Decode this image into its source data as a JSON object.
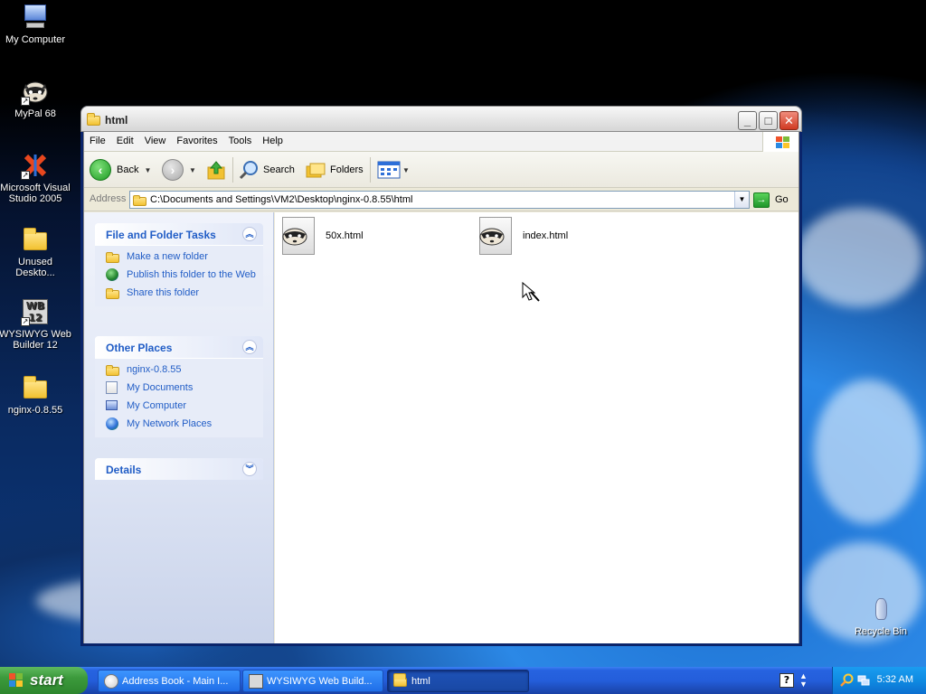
{
  "desktop": {
    "icons": [
      {
        "label": "My Computer"
      },
      {
        "label": "MyPal 68"
      },
      {
        "label": "Microsoft Visual Studio 2005"
      },
      {
        "label": "Unused Deskto..."
      },
      {
        "label": "WYSIWYG Web Builder 12"
      },
      {
        "label": "nginx-0.8.55"
      },
      {
        "label": "Recycle Bin"
      }
    ]
  },
  "window": {
    "title": "html",
    "controls": {
      "minimize": "_",
      "maximize": "□",
      "close": "✕"
    },
    "menu": [
      "File",
      "Edit",
      "View",
      "Favorites",
      "Tools",
      "Help"
    ],
    "toolbar": {
      "back": "Back",
      "search": "Search",
      "folders": "Folders"
    },
    "address": {
      "label": "Address",
      "path": "C:\\Documents and Settings\\VM2\\Desktop\\nginx-0.8.55\\html",
      "go": "Go"
    },
    "tasks": {
      "file_folder": {
        "title": "File and Folder Tasks",
        "items": [
          "Make a new folder",
          "Publish this folder to the Web",
          "Share this folder"
        ]
      },
      "other_places": {
        "title": "Other Places",
        "items": [
          "nginx-0.8.55",
          "My Documents",
          "My Computer",
          "My Network Places"
        ]
      },
      "details": {
        "title": "Details"
      }
    },
    "files": [
      {
        "name": "50x.html"
      },
      {
        "name": "index.html"
      }
    ]
  },
  "taskbar": {
    "start": "start",
    "tasks": [
      {
        "label": "Address Book - Main I..."
      },
      {
        "label": "WYSIWYG Web Build..."
      },
      {
        "label": "html"
      }
    ],
    "clock": "5:32 AM"
  }
}
